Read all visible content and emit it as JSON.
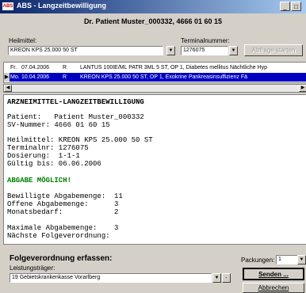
{
  "window": {
    "icon_text": "ABS",
    "title": "ABS - Langzeitbewilligung",
    "min_glyph": "_",
    "max_glyph": "□"
  },
  "patient_header": "Dr. Patient Muster_000332, 4666 01 60 15",
  "form": {
    "heilmittel_label": "Heilmittel:",
    "heilmittel_value": "KREON KPS 25.000 50 ST",
    "terminal_label": "Terminalnummer:",
    "terminal_value": "1276075",
    "abfrage_button": "Abfrage starten",
    "dropdown_glyph": "▼"
  },
  "list_rows": [
    {
      "marker": "",
      "type": "Fr.",
      "date": "07.04.2006",
      "code": "R",
      "text": "LANTUS 100IE/ML PATR 3ML 5 ST, OP 1, Diabetes mellitus Nächtliche Hyp",
      "selected": false
    },
    {
      "marker": "▶",
      "type": "Mo.",
      "date": "10.04.2006",
      "code": "R",
      "text": "KREON KPS 25.000 50 ST, OP 1, Exokrine Pankreasinsuffizienz Fä",
      "selected": true
    }
  ],
  "scroll": {
    "left": "◀",
    "right": "▶"
  },
  "document": {
    "heading": "ARZNEIMITTEL-LANGZEITBEWILLIGUNG",
    "patient_line": "Patient:   Patient Muster_000332",
    "sv_line": "SV-Nummer: 4666 01 60 15",
    "heilmittel_line": "Heilmittel: KREON KPS 25.000 50 ST",
    "terminal_line": "Terminalnr: 1276075",
    "dosierung_line": "Dosierung:  1-1-1",
    "gueltig_line": "Gültig bis: 06.06.2006",
    "abgabe": "ABGABE MÖGLICH!",
    "bewilligte_line": "Bewilligte Abgabemenge:  11",
    "offene_line": "Offene Abgabemenge:      3",
    "monats_line": "Monatsbedarf:            2",
    "maximale_line": "Maximale Abgabemenge:    3",
    "naechste_line": "Nächste Folgeverordnung:"
  },
  "footer": {
    "folgeverordnung_title": "Folgeverordnung erfassen:",
    "leistungstraeger_label": "Leistungsträger:",
    "leistungstraeger_value": "19  Gebietskrankenkasse Vorarlberg",
    "minus_glyph": "-",
    "packungen_label": "Packungen:",
    "packungen_value": "1",
    "senden_button": "Senden ...",
    "abbrechen_button": "Abbrechen"
  }
}
